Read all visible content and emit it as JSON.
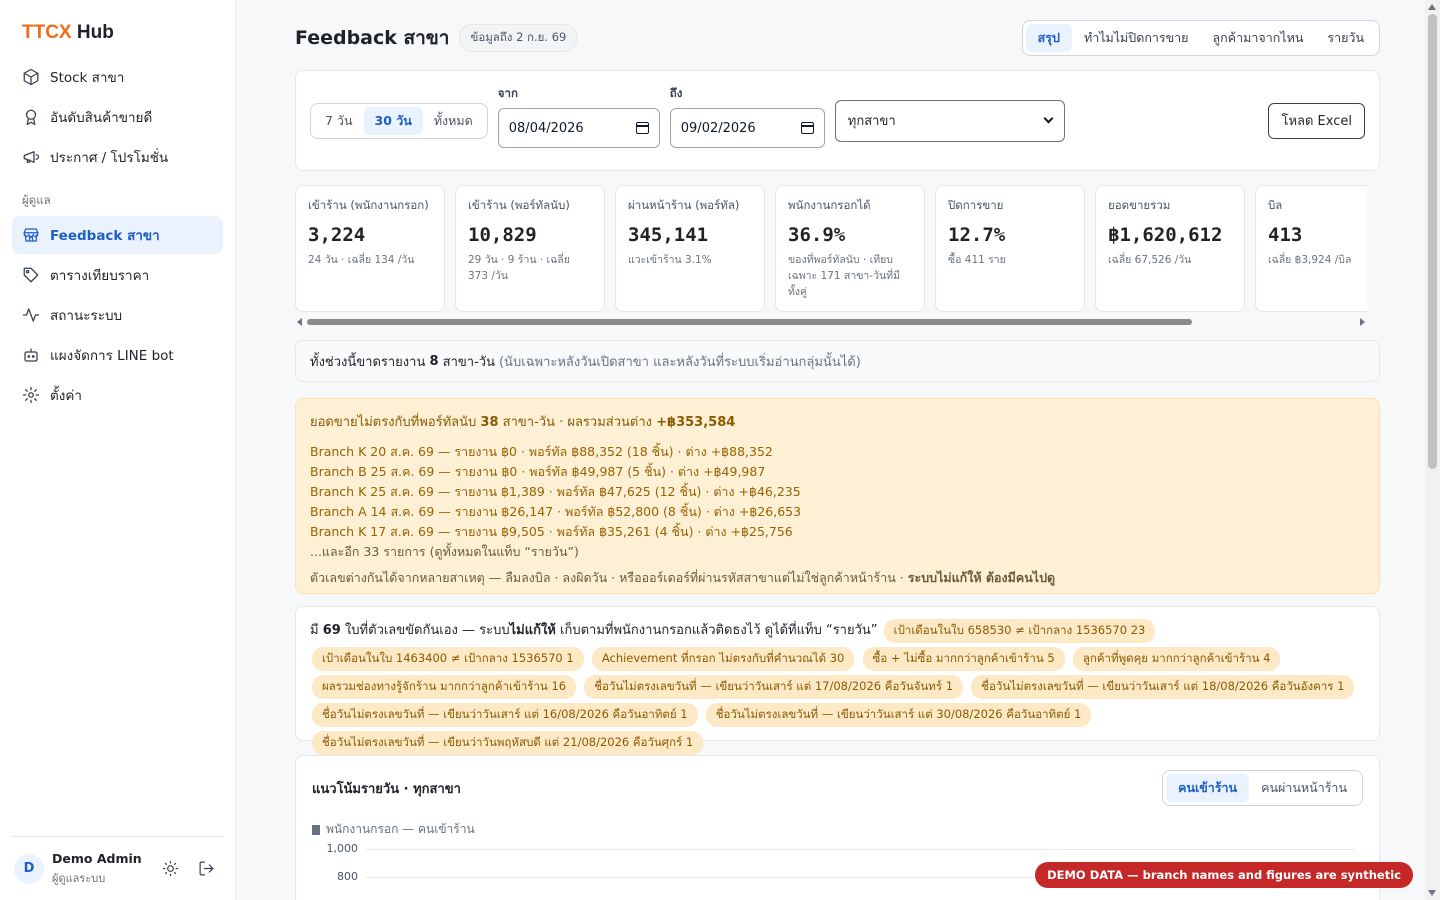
{
  "brand": {
    "primary": "TTCX",
    "secondary": "Hub"
  },
  "nav": {
    "top_items": [
      {
        "label": "Stock สาขา"
      },
      {
        "label": "อันดับสินค้าขายดี"
      },
      {
        "label": "ประกาศ / โปรโมชั่น"
      }
    ],
    "section_label": "ผู้ดูแล",
    "admin_items": [
      {
        "label": "Feedback สาขา"
      },
      {
        "label": "ตารางเทียบราคา"
      },
      {
        "label": "สถานะระบบ"
      },
      {
        "label": "แผงจัดการ LINE bot"
      },
      {
        "label": "ตั้งค่า"
      }
    ]
  },
  "user": {
    "initial": "D",
    "name": "Demo Admin",
    "role": "ผู้ดูแลระบบ"
  },
  "header": {
    "title": "Feedback สาขา",
    "as_of": "ข้อมูลถึง 2 ก.ย. 69",
    "tabs": [
      "สรุป",
      "ทำไมไม่ปิดการขาย",
      "ลูกค้ามาจากไหน",
      "รายวัน"
    ]
  },
  "filters": {
    "ranges": [
      "7 วัน",
      "30 วัน",
      "ทั้งหมด"
    ],
    "from_label": "จาก",
    "from_value": "08/04/2026",
    "to_label": "ถึง",
    "to_value": "09/02/2026",
    "branch_selected": "ทุกสาขา",
    "excel_label": "โหลด Excel"
  },
  "stats": [
    {
      "label": "เข้าร้าน (พนักงานกรอก)",
      "value": "3,224",
      "sub": "24 วัน · เฉลี่ย 134 /วัน"
    },
    {
      "label": "เข้าร้าน (พอร์ทัลนับ)",
      "value": "10,829",
      "sub": "29 วัน · 9 ร้าน · เฉลี่ย 373 /วัน"
    },
    {
      "label": "ผ่านหน้าร้าน (พอร์ทัล)",
      "value": "345,141",
      "sub": "แวะเข้าร้าน 3.1%"
    },
    {
      "label": "พนักงานกรอกได้",
      "value": "36.9%",
      "sub": "ของที่พอร์ทัลนับ · เทียบเฉพาะ 171 สาขา-วันที่มีทั้งคู่"
    },
    {
      "label": "ปิดการขาย",
      "value": "12.7%",
      "sub": "ซื้อ 411 ราย"
    },
    {
      "label": "ยอดขายรวม",
      "value": "฿1,620,612",
      "sub": "เฉลี่ย 67,526 /วัน"
    },
    {
      "label": "บิล",
      "value": "413",
      "sub": "เฉลี่ย ฿3,924 /บิล"
    }
  ],
  "missing": {
    "prefix": "ทั้งช่วงนี้ขาดรายงาน",
    "count": "8",
    "unit": "สาขา-วัน",
    "note": "(นับเฉพาะหลังวันเปิดสาขา และหลังวันที่ระบบเริ่มอ่านกลุ่มนั้นได้)"
  },
  "mismatch": {
    "title_prefix": "ยอดขายไม่ตรงกับที่พอร์ทัลนับ",
    "count": "38",
    "title_mid": "สาขา-วัน · ผลรวมส่วนต่าง",
    "total": "+฿353,584",
    "lines": [
      "Branch K 20 ส.ค. 69 — รายงาน ฿0 · พอร์ทัล ฿88,352 (18 ชิ้น) · ต่าง +฿88,352",
      "Branch B 25 ส.ค. 69 — รายงาน ฿0 · พอร์ทัล ฿49,987 (5 ชิ้น) · ต่าง +฿49,987",
      "Branch K 25 ส.ค. 69 — รายงาน ฿1,389 · พอร์ทัล ฿47,625 (12 ชิ้น) · ต่าง +฿46,235",
      "Branch A 14 ส.ค. 69 — รายงาน ฿26,147 · พอร์ทัล ฿52,800 (8 ชิ้น) · ต่าง +฿26,653",
      "Branch K 17 ส.ค. 69 — รายงาน ฿9,505 · พอร์ทัล ฿35,261 (4 ชิ้น) · ต่าง +฿25,756"
    ],
    "more": "...และอีก 33 รายการ (ดูทั้งหมดในแท็บ “รายวัน”)",
    "foot_prefix": "ตัวเลขต่างกันได้จากหลายสาเหตุ — ลืมลงบิล · ลงผิดวัน · หรือออร์เดอร์ที่ผ่านรหัสสาขาแต่ไม่ใช่ลูกค้าหน้าร้าน ·",
    "foot_bold": "ระบบไม่แก้ให้ ต้องมีคนไปดู"
  },
  "conflicts": {
    "pre": "มี",
    "count": "69",
    "mid": "ใบที่ตัวเลขขัดกันเอง — ระบบ",
    "bold": "ไม่แก้ให้",
    "post": "เก็บตามที่พนักงานกรอกแล้วติดธงไว้ ดูได้ที่แท็บ “รายวัน”",
    "chips": [
      "เป้าเดือนในใบ 658530 ≠ เป้ากลาง 1536570 23",
      "เป้าเดือนในใบ 1463400 ≠ เป้ากลาง 1536570 1",
      "Achievement ที่กรอก ไม่ตรงกับที่คำนวณได้ 30",
      "ซื้อ + ไม่ซื้อ มากกว่าลูกค้าเข้าร้าน 5",
      "ลูกค้าที่พูดคุย มากกว่าลูกค้าเข้าร้าน 4",
      "ผลรวมช่องทางรู้จักร้าน มากกว่าลูกค้าเข้าร้าน 16",
      "ชื่อวันไม่ตรงเลขวันที่ — เขียนว่าวันเสาร์ แต่ 17/08/2026 คือวันจันทร์ 1",
      "ชื่อวันไม่ตรงเลขวันที่ — เขียนว่าวันเสาร์ แต่ 18/08/2026 คือวันอังคาร 1",
      "ชื่อวันไม่ตรงเลขวันที่ — เขียนว่าวันเสาร์ แต่ 16/08/2026 คือวันอาทิตย์ 1",
      "ชื่อวันไม่ตรงเลขวันที่ — เขียนว่าวันเสาร์ แต่ 30/08/2026 คือวันอาทิตย์ 1",
      "ชื่อวันไม่ตรงเลขวันที่ — เขียนว่าวันพฤหัสบดี แต่ 21/08/2026 คือวันศุกร์ 1"
    ]
  },
  "trend": {
    "title": "แนวโน้มรายวัน · ทุกสาขา",
    "tabs": [
      "คนเข้าร้าน",
      "คนผ่านหน้าร้าน"
    ],
    "legend": "พนักงานกรอก — คนเข้าร้าน",
    "y_ticks": [
      "1,000",
      "800"
    ]
  },
  "demo_badge": "DEMO DATA — branch names and figures are synthetic",
  "colors": {
    "accent": "#1d5fc4",
    "brand": "#f26b1d",
    "warning_bg": "#fdf0d5",
    "demo_badge": "#c62828"
  }
}
